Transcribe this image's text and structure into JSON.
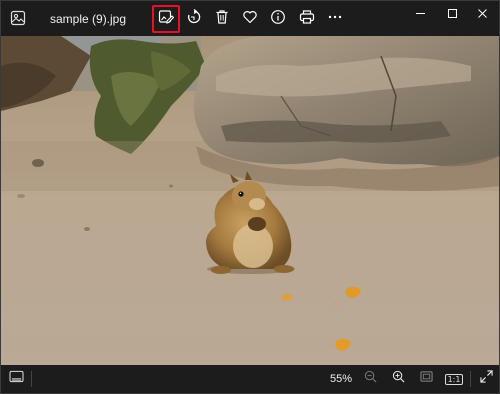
{
  "window": {
    "file_name": "sample (9).jpg"
  },
  "toolbar": {
    "items": [
      {
        "name": "edit-image",
        "icon": "edit-image-icon",
        "highlighted": true,
        "highlight_color": "#e8112d"
      },
      {
        "name": "rotate",
        "icon": "rotate-icon"
      },
      {
        "name": "delete",
        "icon": "trash-icon"
      },
      {
        "name": "favorite",
        "icon": "heart-icon"
      },
      {
        "name": "info",
        "icon": "info-icon"
      },
      {
        "name": "print",
        "icon": "printer-icon"
      },
      {
        "name": "more",
        "icon": "ellipsis-icon"
      }
    ]
  },
  "window_controls": [
    "minimize-icon",
    "maximize-icon",
    "close-icon"
  ],
  "photo": {
    "subject": "squirrel-on-sand-near-rock"
  },
  "bottombar": {
    "zoom_label": "55%",
    "ratio_label": "1:1"
  },
  "colors": {
    "background": "#1c1c1c",
    "highlight": "#e8112d",
    "text": "#f0f0f0"
  }
}
